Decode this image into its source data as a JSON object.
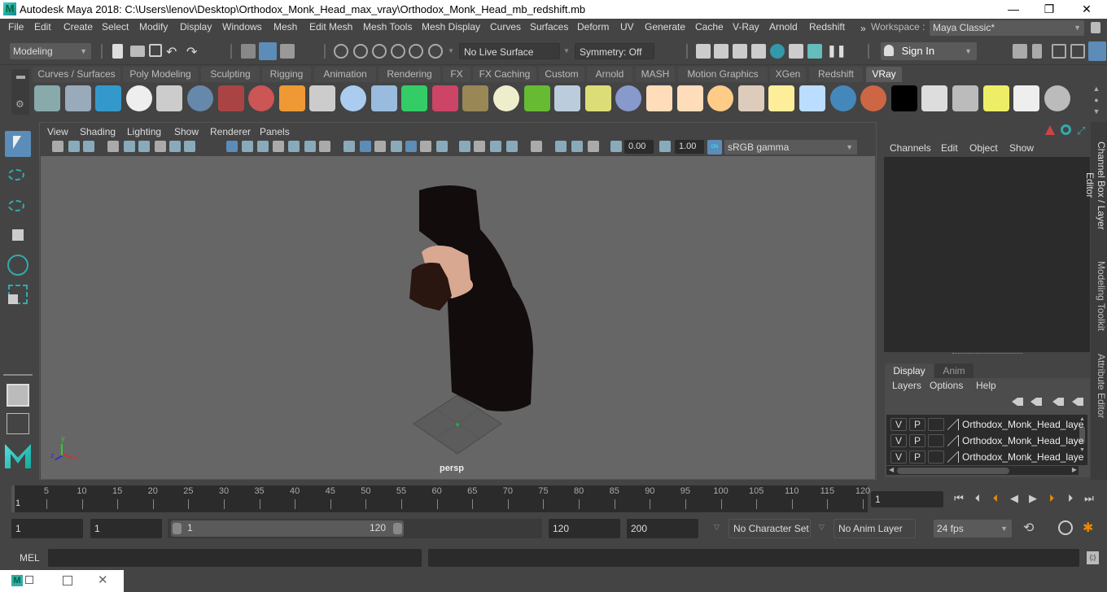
{
  "window": {
    "title": "Autodesk Maya 2018: C:\\Users\\lenov\\Desktop\\Orthodox_Monk_Head_max_vray\\Orthodox_Monk_Head_mb_redshift.mb",
    "logo": "M",
    "minimize": "—",
    "maximize": "❐",
    "close": "✕"
  },
  "menubar": {
    "items": [
      "File",
      "Edit",
      "Create",
      "Select",
      "Modify",
      "Display",
      "Windows",
      "Mesh",
      "Edit Mesh",
      "Mesh Tools",
      "Mesh Display",
      "Curves",
      "Surfaces",
      "Deform",
      "UV",
      "Generate",
      "Cache",
      "V-Ray",
      "Arnold",
      "Redshift"
    ],
    "overflow": "»",
    "workspace_label": "Workspace :",
    "workspace_value": "Maya Classic*"
  },
  "toolbar": {
    "mode": "Modeling",
    "live_surface": "No Live Surface",
    "symmetry": "Symmetry: Off",
    "sign_in": "Sign In"
  },
  "shelf": {
    "tabs": [
      "Curves / Surfaces",
      "Poly Modeling",
      "Sculpting",
      "Rigging",
      "Animation",
      "Rendering",
      "FX",
      "FX Caching",
      "Custom",
      "Arnold",
      "MASH",
      "Motion Graphics",
      "XGen",
      "Redshift",
      "VRay"
    ],
    "active_tab": "VRay",
    "icons": [
      "vray-save-icon",
      "vray-load-icon",
      "vray-list-icon",
      "vray-logo-icon",
      "vray-document-icon",
      "vray-material-icon",
      "vray-camera-icon",
      "vray-spheres-icon",
      "vray-fire-icon",
      "vray-proxy-icon",
      "vray-box-icon",
      "vray-cone-icon",
      "vray-light-icon",
      "vray-mesh-icon",
      "vray-grid-icon",
      "vray-dome-icon",
      "vray-fur-icon",
      "vray-particles-icon",
      "vray-curve-icon",
      "vray-sphere-grid-icon",
      "vray-rect-light-icon",
      "vray-spot-light-icon",
      "vray-omni-light-icon",
      "vray-ies-light-icon",
      "vray-sun-icon",
      "vray-plane-icon",
      "vray-blue-sphere-icon",
      "vray-flag-sphere-icon",
      "vray-checker-icon",
      "vray-frame-buffer-icon",
      "vray-settings-icon",
      "vray-light-lister-icon",
      "vray-cloud-icon",
      "help-icon"
    ]
  },
  "viewport": {
    "menus": [
      "View",
      "Shading",
      "Lighting",
      "Show",
      "Renderer",
      "Panels"
    ],
    "exposure": "0.00",
    "gamma": "1.00",
    "color_mgmt_on": "ON",
    "color_space": "sRGB gamma",
    "camera_label": "persp",
    "axis": {
      "x": "x",
      "y": "y",
      "z": "z"
    }
  },
  "channel_box": {
    "menus": [
      "Channels",
      "Edit",
      "Object",
      "Show"
    ]
  },
  "layer_editor": {
    "tabs": [
      "Display",
      "Anim"
    ],
    "active_tab": "Display",
    "menus": [
      "Layers",
      "Options",
      "Help"
    ],
    "layers": [
      {
        "v": "V",
        "p": "P",
        "name": "Orthodox_Monk_Head_laye"
      },
      {
        "v": "V",
        "p": "P",
        "name": "Orthodox_Monk_Head_laye"
      },
      {
        "v": "V",
        "p": "P",
        "name": "Orthodox_Monk_Head_laye"
      }
    ]
  },
  "side_tabs": [
    "Channel Box / Layer Editor",
    "Modeling Toolkit",
    "Attribute Editor"
  ],
  "timeline": {
    "ticks": [
      5,
      10,
      15,
      20,
      25,
      30,
      35,
      40,
      45,
      50,
      55,
      60,
      65,
      70,
      75,
      80,
      85,
      90,
      95,
      100,
      105,
      110,
      115,
      120
    ],
    "start": 1,
    "end": 120,
    "current": "1",
    "current_frame_field": "1"
  },
  "range": {
    "start_field": "1",
    "playback_start": "1",
    "slider_start": "1",
    "slider_end": "120",
    "playback_end": "120",
    "end_field": "200",
    "character_set": "No Character Set",
    "anim_layer": "No Anim Layer",
    "fps": "24 fps"
  },
  "command_line": {
    "label": "MEL",
    "value": ""
  }
}
